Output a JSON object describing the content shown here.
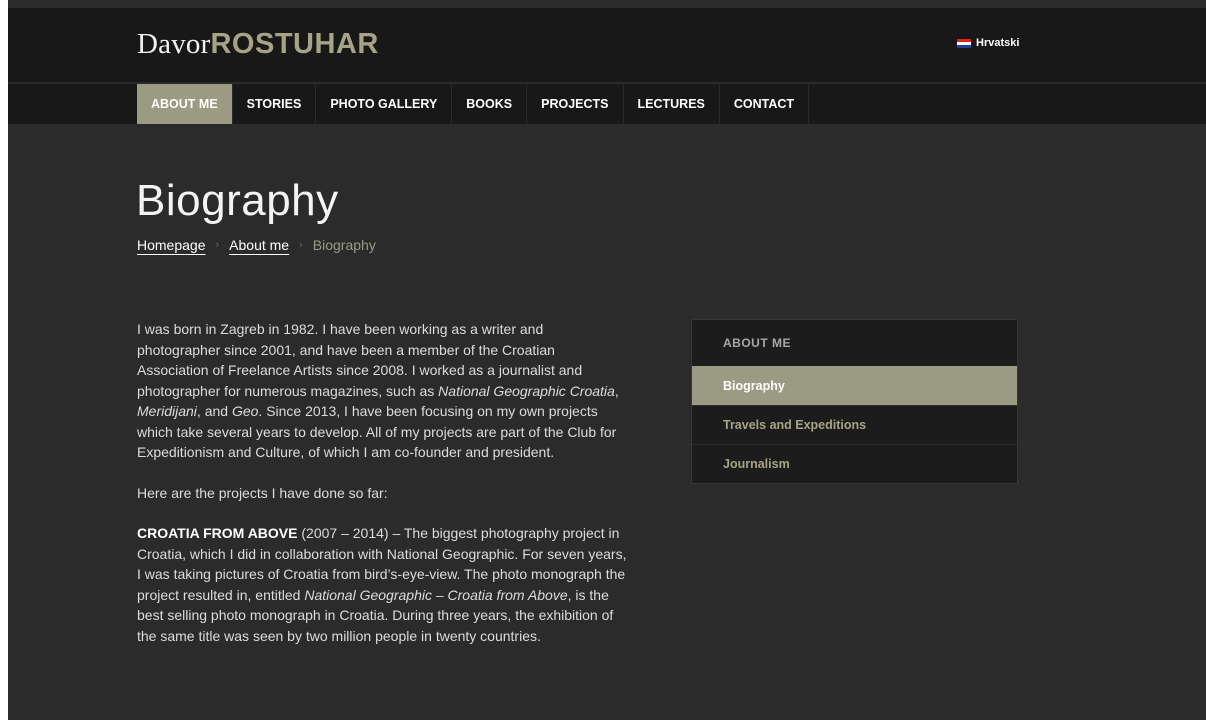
{
  "header": {
    "logo_first": "Davor",
    "logo_last": "ROSTUHAR",
    "language_label": "Hrvatski",
    "flag_colors": [
      "#e2231a",
      "#ffffff",
      "#1f3f95"
    ]
  },
  "nav": {
    "items": [
      {
        "label": "ABOUT ME",
        "active": true
      },
      {
        "label": "STORIES"
      },
      {
        "label": "PHOTO GALLERY"
      },
      {
        "label": "BOOKS"
      },
      {
        "label": "PROJECTS"
      },
      {
        "label": "LECTURES"
      },
      {
        "label": "CONTACT"
      }
    ]
  },
  "page": {
    "title": "Biography",
    "breadcrumb": [
      "Homepage",
      "About me",
      "Biography"
    ]
  },
  "content": {
    "p1": {
      "a": "I was born in Zagreb in 1982. I have been working as a writer and photographer since 2001, and have been a member of the Croatian Association of Freelance Artists since 2008. I worked as a journalist and photographer for numerous magazines, such as ",
      "em1": "National Geographic Croatia",
      "b": ", ",
      "em2": "Meridijani",
      "c": ", and ",
      "em3": "Geo",
      "d": ". Since 2013, I have been focusing on my own projects which take several years to develop. All of my projects are part of the Club for Expeditionism and Culture, of which I am co-founder and president."
    },
    "p2": "Here are the projects I have done so far:",
    "p3": {
      "strong": "CROATIA FROM ABOVE",
      "a": " (2007 – 2014) – The biggest photography project in Croatia, which I did in collaboration with National Geographic. For seven years, I was taking pictures of Croatia from bird’s-eye-view. The photo monograph the project resulted in, entitled ",
      "em": "National Geographic – Croatia from Above",
      "b": ", is the best selling photo monograph in Croatia. During three years, the exhibition of the same title was seen by two million people in twenty countries."
    }
  },
  "sidebar": {
    "title": "ABOUT ME",
    "items": [
      {
        "label": "Biography",
        "active": true
      },
      {
        "label": "Travels and Expeditions"
      },
      {
        "label": "Journalism"
      }
    ]
  },
  "colors": {
    "accent": "#9b9a82",
    "background": "#2b2b2b",
    "header_bg": "#181818"
  }
}
